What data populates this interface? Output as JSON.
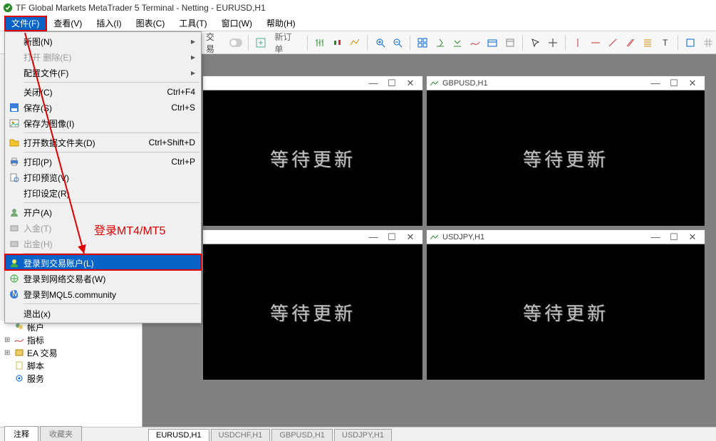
{
  "titlebar": {
    "title": "TF Global Markets MetaTrader 5 Terminal - Netting - EURUSD,H1"
  },
  "menubar": {
    "items": [
      "文件(F)",
      "查看(V)",
      "插入(I)",
      "图表(C)",
      "工具(T)",
      "窗口(W)",
      "帮助(H)"
    ]
  },
  "toolbar": {
    "toggle": "交易",
    "new_order": "新订单"
  },
  "file_menu": {
    "new": {
      "label": "新图(N)"
    },
    "open_deleted": {
      "label": "打开 删除(E)"
    },
    "profiles": {
      "label": "配置文件(F)"
    },
    "close": {
      "label": "关闭(C)",
      "shortcut": "Ctrl+F4"
    },
    "save": {
      "label": "保存(S)",
      "shortcut": "Ctrl+S"
    },
    "save_as_pic": {
      "label": "保存为图像(I)"
    },
    "open_data_folder": {
      "label": "打开数据文件夹(D)",
      "shortcut": "Ctrl+Shift+D"
    },
    "print": {
      "label": "打印(P)",
      "shortcut": "Ctrl+P"
    },
    "print_preview": {
      "label": "打印预览(V)"
    },
    "print_setup": {
      "label": "打印设定(R)"
    },
    "open_account": {
      "label": "开户(A)"
    },
    "deposit": {
      "label": "入金(T)"
    },
    "withdraw": {
      "label": "出金(H)"
    },
    "login_trade": {
      "label": "登录到交易账户(L)"
    },
    "login_web": {
      "label": "登录到网络交易者(W)"
    },
    "login_mql5": {
      "label": "登录到MQL5.community"
    },
    "exit": {
      "label": "退出(x)"
    }
  },
  "annotation": {
    "text": "登录MT4/MT5"
  },
  "charts": {
    "wait_text": "等待更新",
    "panes": [
      {
        "label": ""
      },
      {
        "label": "GBPUSD,H1"
      },
      {
        "label": ""
      },
      {
        "label": "USDJPY,H1"
      }
    ],
    "tabs": [
      "EURUSD,H1",
      "USDCHF,H1",
      "GBPUSD,H1",
      "USDJPY,H1"
    ]
  },
  "nav": {
    "items": [
      "帐户",
      "指标",
      "EA 交易",
      "脚本",
      "服务"
    ],
    "tabs": [
      "注释",
      "收藏夹"
    ]
  }
}
